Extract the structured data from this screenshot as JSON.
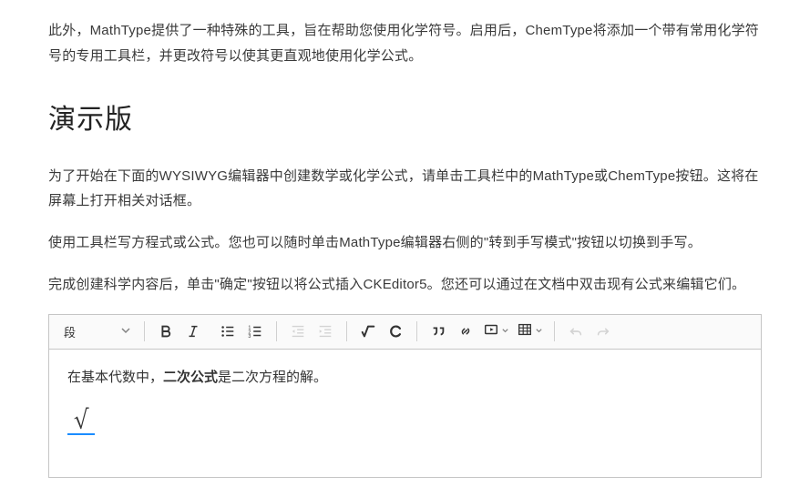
{
  "intro_paragraph": "此外，MathType提供了一种特殊的工具，旨在帮助您使用化学符号。启用后，ChemType将添加一个带有常用化学符号的专用工具栏，并更改符号以使其更直观地使用化学公式。",
  "heading": "演示版",
  "p1": "为了开始在下面的WYSIWYG编辑器中创建数学或化学公式，请单击工具栏中的MathType或ChemType按钮。这将在屏幕上打开相关对话框。",
  "p2": "使用工具栏写方程式或公式。您也可以随时单击MathType编辑器右侧的\"转到手写模式\"按钮以切换到手写。",
  "p3": "完成创建科学内容后，单击\"确定\"按钮以将公式插入CKEditor5。您还可以通过在文档中双击现有公式来编辑它们。",
  "toolbar": {
    "block_label": "段",
    "icons": {
      "bold": "bold-icon",
      "italic": "italic-icon",
      "ul": "bulleted-list-icon",
      "ol": "numbered-list-icon",
      "outdent": "decrease-indent-icon",
      "indent": "increase-indent-icon",
      "math": "mathtype-icon",
      "chem": "chemtype-icon",
      "quote": "block-quote-icon",
      "link": "link-icon",
      "media": "media-embed-icon",
      "table": "insert-table-icon",
      "undo": "undo-icon",
      "redo": "redo-icon"
    }
  },
  "editor": {
    "line1_pre": "在基本代数中，",
    "line1_bold": "二次公式",
    "line1_post": "是二次方程的解。",
    "math_symbol": "√"
  }
}
